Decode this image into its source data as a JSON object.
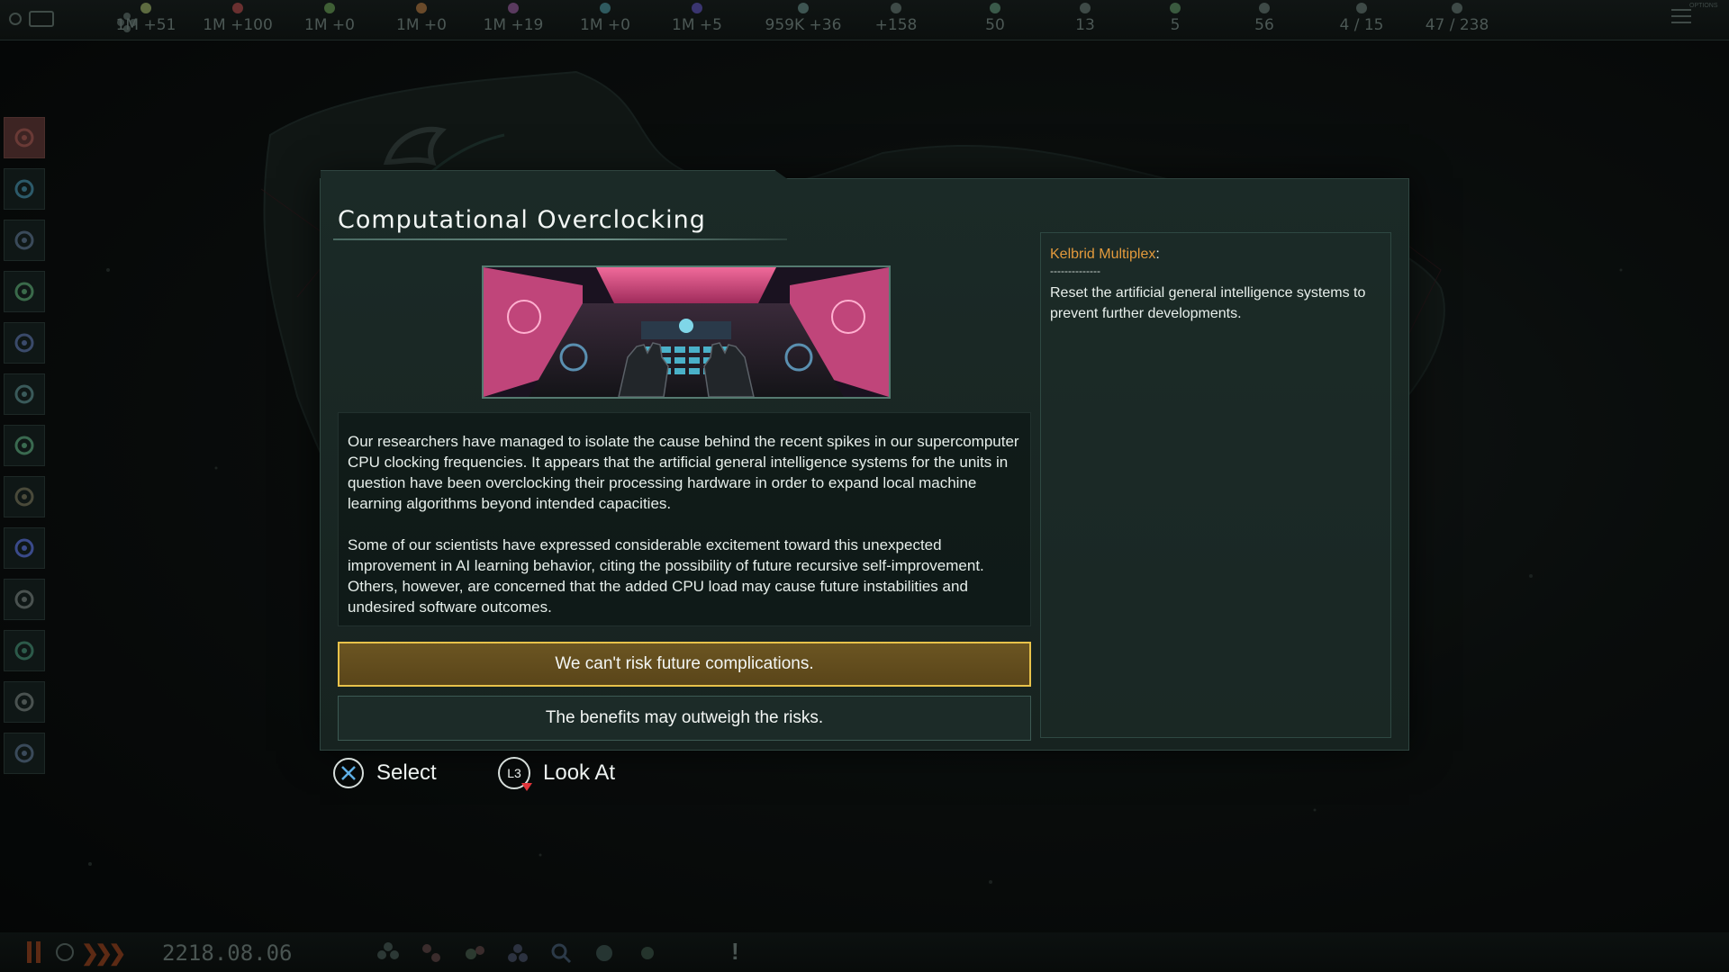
{
  "topbar": {
    "resources": [
      {
        "icon": "energy-icon",
        "value": "1M +51",
        "color": "#5d6b40"
      },
      {
        "icon": "minerals-icon",
        "value": "1M +100",
        "color": "#6a3030"
      },
      {
        "icon": "food-icon",
        "value": "1M +0",
        "color": "#3f5f35"
      },
      {
        "icon": "consumer-goods-icon",
        "value": "1M +0",
        "color": "#6a4a2a"
      },
      {
        "icon": "alloys-icon",
        "value": "1M +19",
        "color": "#5a3a5f"
      },
      {
        "icon": "exotic-gases-icon",
        "value": "1M +0",
        "color": "#2f5a5f"
      },
      {
        "icon": "influence-icon",
        "value": "1M +5",
        "color": "#3a3570"
      },
      {
        "icon": "unity-icon",
        "value": "959K +36",
        "color": "#3e5552"
      },
      {
        "icon": "research-icon",
        "value": "+158",
        "color": "#3e4a47"
      },
      {
        "icon": "amenities-icon",
        "value": "50",
        "color": "#3a5a4a"
      },
      {
        "icon": "naval-capacity-icon",
        "value": "13",
        "color": "#3e4a47"
      },
      {
        "icon": "starbase-capacity-icon",
        "value": "5",
        "color": "#3a5a3f"
      },
      {
        "icon": "pops-icon",
        "value": "56",
        "color": "#3e4a47"
      },
      {
        "icon": "planets-icon",
        "value": "4 / 15",
        "color": "#3e4a47"
      },
      {
        "icon": "leaders-icon",
        "value": "47 / 238",
        "color": "#3e4a47"
      }
    ],
    "options_label": "OPTIONS"
  },
  "sidebar": {
    "items": [
      {
        "name": "empire-emblem-icon"
      },
      {
        "name": "situation-log-icon"
      },
      {
        "name": "government-icon"
      },
      {
        "name": "technology-icon"
      },
      {
        "name": "planets-icon"
      },
      {
        "name": "contacts-icon"
      },
      {
        "name": "traditions-icon"
      },
      {
        "name": "species-icon"
      },
      {
        "name": "ascension-icon"
      },
      {
        "name": "fleet-manager-icon"
      },
      {
        "name": "factions-icon"
      },
      {
        "name": "galactic-community-icon"
      },
      {
        "name": "ship-designer-icon"
      }
    ]
  },
  "event": {
    "title": "Computational Overclocking",
    "image_name": "supercomputer-lab-picture",
    "paragraph1": "Our researchers have managed to isolate the cause behind the recent spikes in our supercomputer CPU clocking frequencies. It appears that the artificial general intelligence systems for the units in question have been overclocking their processing hardware in order to expand local machine learning algorithms beyond intended capacities.",
    "paragraph2": "Some of our scientists have expressed considerable excitement toward this unexpected improvement in AI learning behavior, citing the possibility of future recursive self-improvement. Others, however, are concerned that the added CPU load may cause future instabilities and undesired software outcomes.",
    "options": [
      {
        "label": "We can't risk future complications.",
        "selected": true
      },
      {
        "label": "The benefits may outweigh the risks.",
        "selected": false
      }
    ],
    "effects": {
      "target": "Kelbrid Multiplex",
      "colon": ":",
      "separator": "--------------",
      "text": "Reset the artificial general intelligence systems to prevent further developments."
    }
  },
  "hints": {
    "select_label": "Select",
    "look_label": "Look At",
    "l3_label": "L3"
  },
  "bottombar": {
    "date": "2218.08.06",
    "speed_arrows": "❯❯❯",
    "alert_symbol": "!"
  },
  "colors": {
    "accent_gold": "#e8c24a",
    "effect_name": "#e39a3c",
    "panel_bg": "#1b2a27"
  }
}
